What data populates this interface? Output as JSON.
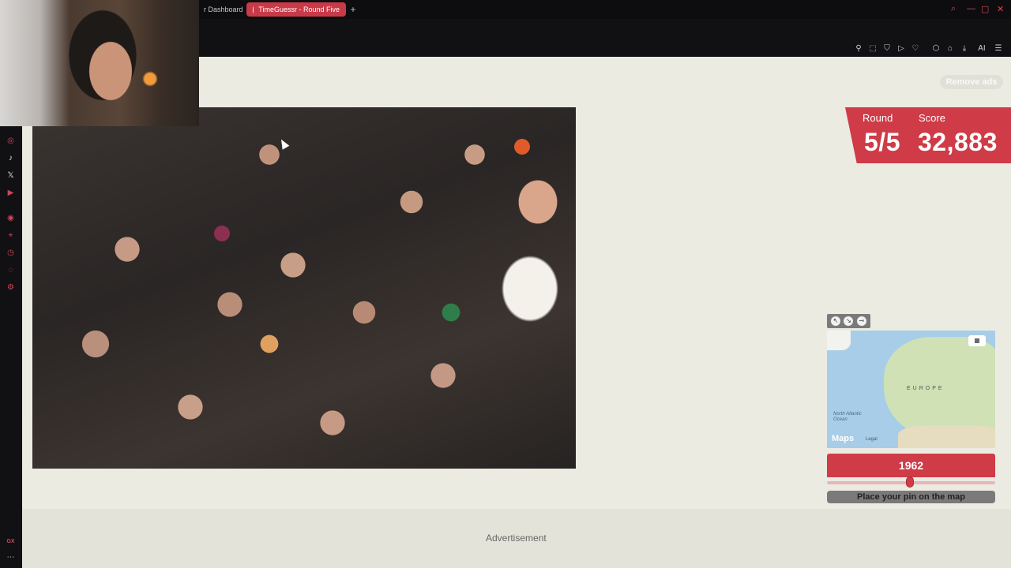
{
  "browser": {
    "tabs": [
      {
        "label": "r Dashboard"
      },
      {
        "label": "TimeGuessr - Round Five"
      }
    ],
    "new_tab": "+",
    "toolbar_icons": [
      "pin-icon",
      "screenshot-icon",
      "shield-icon",
      "play-icon",
      "heart-icon",
      "box-icon",
      "lock-icon",
      "download-icon",
      "ai-icon",
      "menu-icon"
    ],
    "ai_label": "AI"
  },
  "sidebar": {
    "icons": [
      "instagram-icon",
      "tiktok-icon",
      "x-icon",
      "youtube-icon",
      "player-icon",
      "pin-icon",
      "clock-icon",
      "chat-icon",
      "settings-icon"
    ],
    "bottom_label": "GX"
  },
  "page": {
    "remove_ads": "Remove ads",
    "round_label": "Round",
    "round_value": "5/5",
    "score_label": "Score",
    "score_value": "32,883",
    "map": {
      "region_label": "EUROPE",
      "ocean_label": "North Atlantic Ocean",
      "brand": "Maps",
      "legal": "Legal"
    },
    "year": "1962",
    "place_pin": "Place your pin on the map",
    "advertisement": "Advertisement"
  },
  "colors": {
    "accent": "#cf3b47",
    "page_bg": "#ecebe2"
  }
}
